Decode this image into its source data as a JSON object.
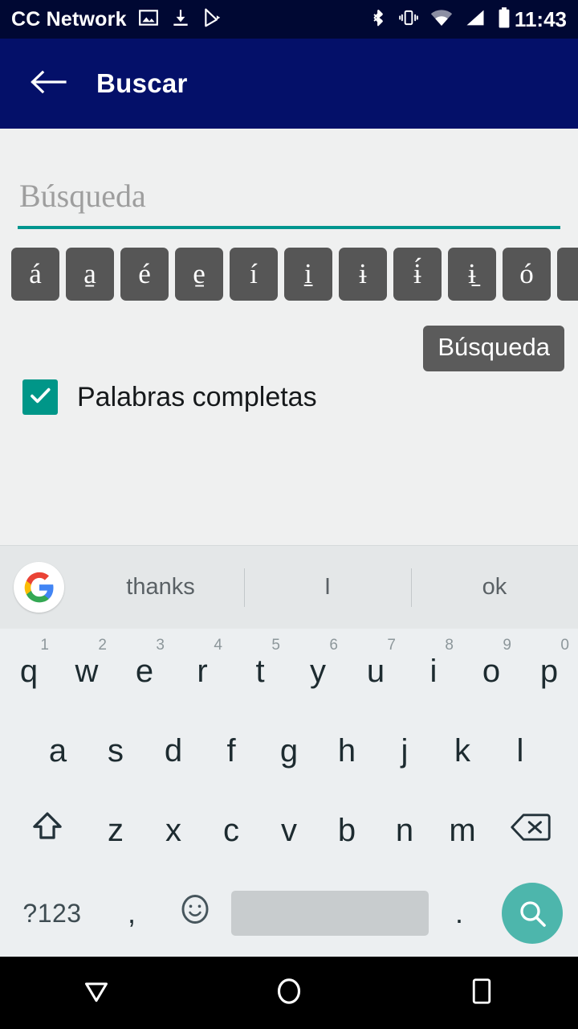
{
  "status_bar": {
    "carrier": "CC Network",
    "clock": "11:43",
    "left_icons": [
      "image-icon",
      "download-icon",
      "play-store-icon"
    ],
    "right_icons": [
      "bluetooth-icon",
      "vibrate-icon",
      "wifi-icon",
      "signal-icon",
      "battery-icon"
    ],
    "background": "#000833"
  },
  "app_bar": {
    "back_label": "back-arrow-icon",
    "title": "Buscar",
    "background": "#041069",
    "text_color": "#ffffff"
  },
  "search": {
    "value": "",
    "placeholder": "Búsqueda",
    "underline_color": "#00968f"
  },
  "accent_keys": {
    "items": [
      {
        "char": "á"
      },
      {
        "char": "a̱"
      },
      {
        "char": "é"
      },
      {
        "char": "e̱"
      },
      {
        "char": "í"
      },
      {
        "char": "i̱"
      },
      {
        "char": "ɨ"
      },
      {
        "char": "ɨ́"
      },
      {
        "char": "ɨ̱"
      },
      {
        "char": "ó"
      },
      {
        "char": ""
      }
    ],
    "key_background": "#565656",
    "key_text_color": "#ffffff"
  },
  "tooltip": {
    "text": "Búsqueda",
    "background": "#5b5b5b"
  },
  "whole_words": {
    "label": "Palabras completas",
    "checked": true,
    "accent_color": "#009688",
    "check_glyph": "check-icon"
  },
  "keyboard": {
    "background": "#eceff1",
    "suggestion_bar": {
      "background": "#e4e7e8",
      "logo": "google-g-icon",
      "suggestions": [
        "thanks",
        "I",
        "ok"
      ]
    },
    "rows": [
      {
        "name": "row-1",
        "keys": [
          {
            "label": "q",
            "num": "1"
          },
          {
            "label": "w",
            "num": "2"
          },
          {
            "label": "e",
            "num": "3"
          },
          {
            "label": "r",
            "num": "4"
          },
          {
            "label": "t",
            "num": "5"
          },
          {
            "label": "y",
            "num": "6"
          },
          {
            "label": "u",
            "num": "7"
          },
          {
            "label": "i",
            "num": "8"
          },
          {
            "label": "o",
            "num": "9"
          },
          {
            "label": "p",
            "num": "0"
          }
        ]
      },
      {
        "name": "row-2",
        "keys": [
          {
            "label": "a"
          },
          {
            "label": "s"
          },
          {
            "label": "d"
          },
          {
            "label": "f"
          },
          {
            "label": "g"
          },
          {
            "label": "h"
          },
          {
            "label": "j"
          },
          {
            "label": "k"
          },
          {
            "label": "l"
          }
        ]
      },
      {
        "name": "row-3",
        "keys": [
          {
            "label": "",
            "icon": "shift-icon"
          },
          {
            "label": "z"
          },
          {
            "label": "x"
          },
          {
            "label": "c"
          },
          {
            "label": "v"
          },
          {
            "label": "b"
          },
          {
            "label": "n"
          },
          {
            "label": "m"
          },
          {
            "label": "",
            "icon": "backspace-icon"
          }
        ]
      },
      {
        "name": "row-4",
        "keys": [
          {
            "label": "?123"
          },
          {
            "label": ","
          },
          {
            "label": "",
            "icon": "emoji-icon"
          },
          {
            "label": "",
            "icon": "spacebar"
          },
          {
            "label": "."
          },
          {
            "label": "",
            "icon": "search-icon"
          }
        ]
      }
    ],
    "symbols_label": "?123",
    "comma_label": ",",
    "period_label": ".",
    "go_button_color": "#4db6ac"
  },
  "nav_bar": {
    "background": "#000000",
    "buttons": [
      "back-triangle-icon",
      "home-circle-icon",
      "recents-square-icon"
    ]
  }
}
